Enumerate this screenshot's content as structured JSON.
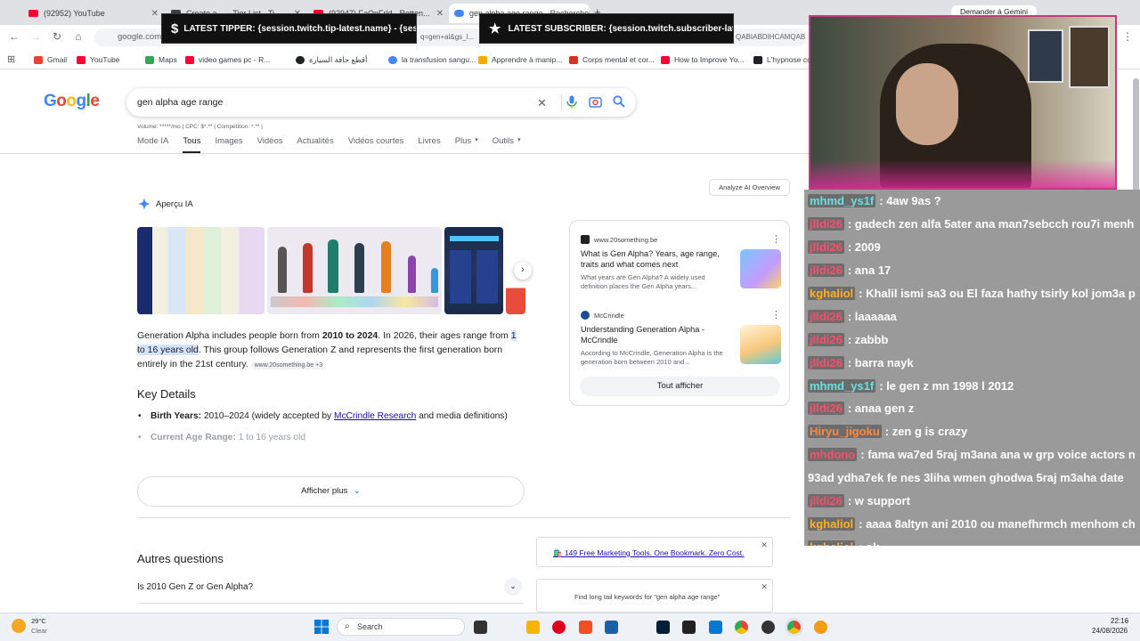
{
  "browser": {
    "tabs": [
      {
        "label": "(92952) YouTube",
        "color": "#ff0033"
      },
      {
        "label": "Create a ... - Tier List - Ti...",
        "color": "#3c4043"
      },
      {
        "label": "(92947) FaOnFrld - Rotten...",
        "color": "#ff0033"
      },
      {
        "label": "gen alpha age range - Rechercher",
        "color": "#4285f4"
      }
    ],
    "new_tab": "+",
    "url": "google.com",
    "url_tail": "QABIABDIHCAMQAB",
    "url_mid": "q=gen+al&gs_l...",
    "gemini": "Demander à Gemini",
    "bookmarks": [
      "Gmail",
      "YouTube",
      "Maps",
      "video games pc - R...",
      "أقطع حافة السيارة",
      "la transfusion sangu...",
      "Apprendre à manip...",
      "Corps mental et cor...",
      "How to Improve Yo...",
      "L'hypnose co..."
    ]
  },
  "overlays": {
    "tipper": "LATEST TIPPER: {session.twitch.tip-latest.name} - {session.twitch.",
    "subscriber": "LATEST SUBSCRIBER: {session.twitch.subscriber-latest.name}"
  },
  "google": {
    "logo": "Google",
    "query": "gen alpha age range",
    "volume": "Volume: *****/mo | CPC: $*.** | Competition: *.** |",
    "tabs": [
      "Mode IA",
      "Tous",
      "Images",
      "Vidéos",
      "Actualités",
      "Vidéos courtes",
      "Livres",
      "Plus",
      "Outils"
    ],
    "analyze": "Analyze AI Overview",
    "ai_title": "Aperçu IA",
    "answer_a": "Generation Alpha includes people born from ",
    "answer_b": "2010 to 2024",
    "answer_c": ". In 2026, their ages range from ",
    "answer_d": "1 to 16 years old",
    "answer_e": ". This group follows Generation Z and represents the first generation born entirely in the 21st century.",
    "citation": "www.20something.be +3",
    "key_details": "Key Details",
    "bullet1_label": "Birth Years:",
    "bullet1_text": " 2010–2024 (widely accepted by ",
    "bullet1_link": "McCrindle Research",
    "bullet1_end": " and media definitions)",
    "bullet2_label": "Current Age Range:",
    "bullet2_text": " 1 to 16 years old",
    "more": "Afficher plus",
    "sources": [
      {
        "site": "www.20something.be",
        "title": "What is Gen Alpha? Years, age range, traits and what comes next",
        "snippet": "What years are Gen Alpha? A widely used definition places the Gen Alpha years..."
      },
      {
        "site": "McCrindle",
        "title": "Understanding Generation Alpha - McCrindle",
        "snippet": "According to McCrindle, Generation Alpha is the generation born between 2010 and..."
      }
    ],
    "show_all": "Tout afficher",
    "autres": "Autres questions",
    "question1": "Is 2010 Gen Z or Gen Alpha?",
    "ad1": "🛍️ 149 Free Marketing Tools. One Bookmark. Zero Cost.",
    "ad2": "Find long tail keywords for \"gen alpha age range\""
  },
  "chat": [
    {
      "name": "mhmd_ys1f",
      "text": ": 4aw 9as ?",
      "color": "#66e0e0"
    },
    {
      "name": "jlldi26",
      "text": ": gadech zen alfa 5ater ana man7sebcch rou7i menh",
      "color": "#ff4d6d"
    },
    {
      "name": "jlldi26",
      "text": ": 2009",
      "color": "#ff4d6d"
    },
    {
      "name": "jlldi26",
      "text": ": ana 17",
      "color": "#ff4d6d"
    },
    {
      "name": "kghaliol",
      "text": ": Khalil ismi sa3 ou El faza hathy tsirly kol jom3a p",
      "color": "#ffb020"
    },
    {
      "name": "jlldi26",
      "text": ": laaaaaa",
      "color": "#ff4d6d"
    },
    {
      "name": "jlldi26",
      "text": ": zabbb",
      "color": "#ff4d6d"
    },
    {
      "name": "jlldi26",
      "text": ": barra nayk",
      "color": "#ff4d6d"
    },
    {
      "name": "mhmd_ys1f",
      "text": ": le gen z mn 1998 l 2012",
      "color": "#66e0e0"
    },
    {
      "name": "jlldi26",
      "text": ": anaa gen z",
      "color": "#ff4d6d"
    },
    {
      "name": "Hiryu_jigoku",
      "text": ": zen g is crazy",
      "color": "#ff8a3d"
    },
    {
      "name": "mhdono",
      "text": ": fama wa7ed 5raj m3ana ana w grp voice actors n",
      "color": "#ff4d6d"
    },
    {
      "name": "",
      "text": "93ad ydha7ek fe nes 3liha wmen ghodwa 5raj m3aha date",
      "color": "#ff4d6d"
    },
    {
      "name": "jlldi26",
      "text": ": w support",
      "color": "#ff4d6d"
    },
    {
      "name": "kghaliol",
      "text": ": aaaa 8altyn ani 2010 ou manefhrmch menhom ch",
      "color": "#ffb020"
    },
    {
      "name": "kghaliol",
      "text": ": ok",
      "color": "#ffb020"
    }
  ],
  "taskbar": {
    "weather_temp": "29°C",
    "weather_desc": "Clear",
    "search": "Search",
    "time": "22:16",
    "date": "24/08/2026"
  }
}
